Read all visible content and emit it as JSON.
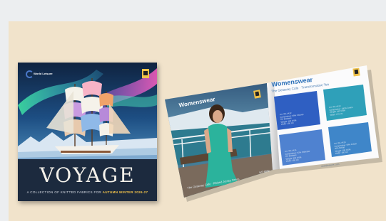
{
  "cover": {
    "brand": "World Leisure",
    "title": "VOYAGE",
    "tagline_prefix": "A COLLECTION OF KNITTED FABRICS FOR ",
    "tagline_season": "AUTUMN WINTER 2026-27"
  },
  "brochure": {
    "left_page": {
      "heading": "Womenswear",
      "footer": "The Getaway Cafe · Ribbed Jersey Dress",
      "code": "WT-8852"
    },
    "right_page": {
      "heading": "Womenswear",
      "subheading": "The Getaway Cafe · Transformative Tee",
      "footer": "worldleisure.com",
      "swatches": [
        {
          "label": "Art. WL-4412\nComposition: 95% Viscose\n5% Elastane\nWeight: 180 GSM\nWidth: 150 cm",
          "color": "#2f5fc2"
        },
        {
          "label": "Art. WL-4413\nComposition: 100% Cotton\nWeight: 160 GSM\nWidth: 170 cm",
          "color": "#2fa0b9"
        },
        {
          "label": "Art. WL-4414\nComposition: 92% Polyester\n8% Elastane\nWeight: 200 GSM\nWidth: 155 cm",
          "color": "#4f82d0"
        },
        {
          "label": "Art. WL-4415\nComposition: 60% Cotton\n40% Modal\nWeight: 190 GSM\nWidth: 160 cm",
          "color": "#3f86c9"
        }
      ]
    }
  },
  "colors": {
    "background": "#eceef0",
    "panel": "#f1e3cb",
    "cover_navy": "#1c2a3e",
    "accent_gold": "#f0c24a",
    "heading_blue": "#2a6fb7"
  }
}
